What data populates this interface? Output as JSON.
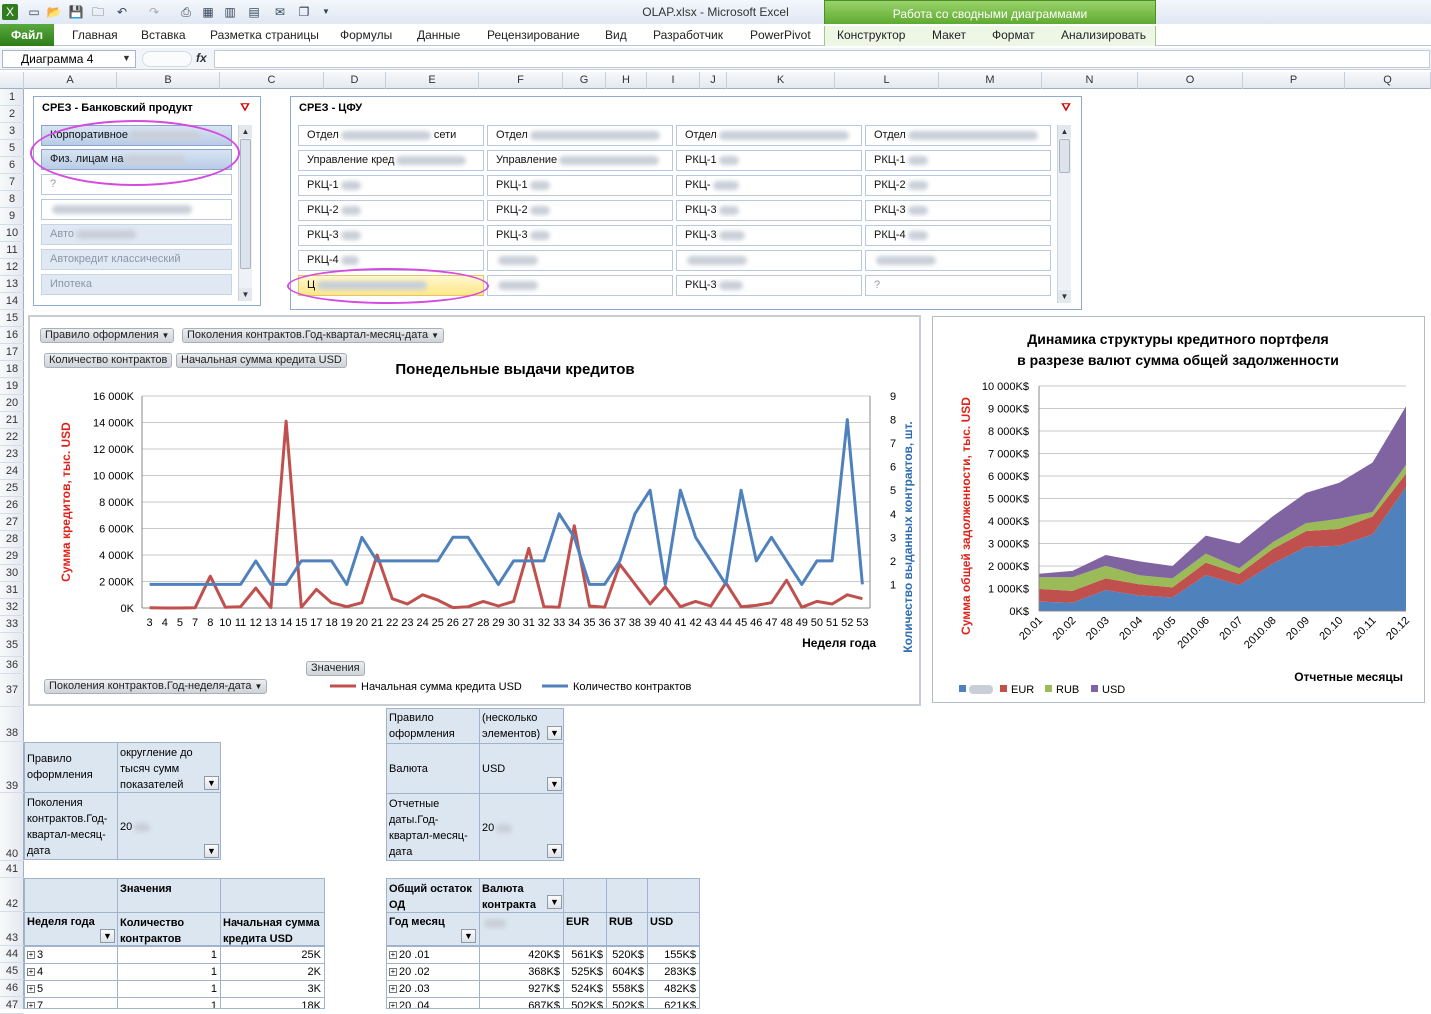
{
  "window": {
    "title": "OLAP.xlsx  -  Microsoft Excel",
    "context_group": "Работа со сводными диаграммами"
  },
  "ribbon": {
    "file_tab": "Файл",
    "tabs": [
      "Главная",
      "Вставка",
      "Разметка страницы",
      "Формулы",
      "Данные",
      "Рецензирование",
      "Вид",
      "Разработчик",
      "PowerPivot"
    ],
    "context_tabs": [
      "Конструктор",
      "Макет",
      "Формат",
      "Анализировать"
    ]
  },
  "formula_bar": {
    "name_box": "Диаграмма 4",
    "fx": "fx",
    "value": ""
  },
  "columns": [
    "A",
    "B",
    "C",
    "D",
    "E",
    "F",
    "G",
    "H",
    "I",
    "J",
    "K",
    "L",
    "M",
    "N",
    "O",
    "P",
    "Q"
  ],
  "rows": [
    "1",
    "2",
    "3",
    "5",
    "6",
    "7",
    "8",
    "9",
    "10",
    "11",
    "12",
    "13",
    "14",
    "15",
    "16",
    "17",
    "18",
    "19",
    "20",
    "21",
    "22",
    "23",
    "24",
    "25",
    "26",
    "27",
    "28",
    "29",
    "30",
    "31",
    "32",
    "33",
    "35",
    "36",
    "37",
    "38",
    "39",
    "40",
    "41",
    "42",
    "43",
    "44",
    "45",
    "46",
    "47"
  ],
  "slicer_product": {
    "title": "СРЕЗ - Банковский продукт",
    "items": [
      "Корпоративное",
      "Физ. лицам на",
      "?",
      "",
      "Авто",
      "Автокредит классический",
      "Ипотека"
    ]
  },
  "slicer_cfu": {
    "title": "СРЕЗ - ЦФУ",
    "items": [
      [
        "Отдел",
        "Отдел",
        "Отдел",
        "Отдел"
      ],
      [
        "Управление кред",
        "Управление",
        "РКЦ-1",
        "РКЦ-1"
      ],
      [
        "РКЦ-1",
        "РКЦ-1",
        "РКЦ-",
        "РКЦ-2"
      ],
      [
        "РКЦ-2",
        "РКЦ-2",
        "РКЦ-3",
        "РКЦ-3"
      ],
      [
        "РКЦ-3",
        "РКЦ-3",
        "РКЦ-3",
        "РКЦ-4"
      ],
      [
        "РКЦ-4",
        "",
        "",
        ""
      ],
      [
        "Ц",
        "",
        "РКЦ-3",
        "?"
      ]
    ],
    "row1_suffixes": [
      "сети",
      "",
      "",
      ""
    ]
  },
  "chart_weekly": {
    "filter_buttons": [
      "Правило оформления",
      "Поколения контрактов.Год-квартал-месяц-дата"
    ],
    "value_buttons": [
      "Количество контрактов",
      "Начальная сумма кредита USD"
    ],
    "values_button": "Значения",
    "axis_button": "Поколения контрактов.Год-неделя-дата",
    "legend_entries": [
      "Начальная сумма кредита USD",
      "Количество контрактов"
    ]
  },
  "chart_data": [
    {
      "type": "line",
      "title": "Понедельные выдачи кредитов",
      "xlabel": "Неделя года",
      "ylabel": "Сумма кредитов, тыс. USD",
      "y2label": "Количество выданных контрактов, шт.",
      "ylim": [
        0,
        16000
      ],
      "y2lim": [
        0,
        9
      ],
      "y_ticks": [
        "0K",
        "2 000K",
        "4 000K",
        "6 000K",
        "8 000K",
        "10 000K",
        "12 000K",
        "14 000K",
        "16 000K"
      ],
      "y2_ticks": [
        "1",
        "2",
        "3",
        "4",
        "5",
        "6",
        "7",
        "8",
        "9"
      ],
      "categories": [
        "3",
        "4",
        "5",
        "7",
        "8",
        "10",
        "11",
        "12",
        "13",
        "14",
        "15",
        "17",
        "18",
        "19",
        "20",
        "21",
        "22",
        "23",
        "24",
        "25",
        "26",
        "27",
        "28",
        "29",
        "30",
        "31",
        "32",
        "33",
        "34",
        "35",
        "36",
        "37",
        "38",
        "39",
        "40",
        "41",
        "42",
        "43",
        "44",
        "45",
        "46",
        "47",
        "48",
        "49",
        "50",
        "51",
        "52",
        "53"
      ],
      "legend": "bottom",
      "series": [
        {
          "name": "Начальная сумма кредита USD",
          "axis": "left",
          "color": "#c0504d",
          "values": [
            25,
            2,
            3,
            18,
            2400,
            50,
            100,
            1500,
            30,
            14100,
            50,
            1400,
            400,
            100,
            400,
            4000,
            700,
            300,
            1000,
            600,
            30,
            100,
            500,
            150,
            500,
            4500,
            100,
            50,
            6200,
            150,
            50,
            3300,
            1800,
            300,
            1600,
            100,
            500,
            150,
            1900,
            100,
            200,
            400,
            2100,
            50,
            500,
            300,
            1000,
            700
          ]
        },
        {
          "name": "Количество контрактов",
          "axis": "right",
          "color": "#4f81bd",
          "values": [
            1,
            1,
            1,
            1,
            1,
            1,
            1,
            2,
            1,
            1,
            2,
            2,
            2,
            1,
            3,
            2,
            2,
            2,
            2,
            2,
            3,
            3,
            2,
            1,
            2,
            2,
            2,
            4,
            3,
            1,
            1,
            2,
            4,
            5,
            1,
            5,
            3,
            2,
            1,
            5,
            2,
            3,
            2,
            1,
            2,
            2,
            8,
            1
          ]
        }
      ]
    },
    {
      "type": "area",
      "title": "Динамика  структуры  кредитного портфеля\nв разрезе  валют сумма общей задолженности",
      "xlabel": "Отчетные месяцы",
      "ylabel": "Сумма общей задолженности, тыс. USD",
      "ylim": [
        0,
        10000
      ],
      "y_ticks": [
        "0K$",
        "1 000K$",
        "2 000K$",
        "3 000K$",
        "4 000K$",
        "5 000K$",
        "6 000K$",
        "7 000K$",
        "8 000K$",
        "9 000K$",
        "10 000K$"
      ],
      "categories": [
        "20.01",
        "20.02",
        "20.03",
        "20.04",
        "20.05",
        "2010.06",
        "20.07",
        "2010.08",
        "20.09",
        "20.10",
        "20.11",
        "20.12"
      ],
      "stacked": true,
      "legend": "bottom",
      "series": [
        {
          "name": "",
          "color": "#4f81bd",
          "values": [
            420,
            368,
            927,
            687,
            600,
            1600,
            1150,
            2100,
            2850,
            2900,
            3400,
            5500
          ]
        },
        {
          "name": "EUR",
          "color": "#c0504d",
          "values": [
            561,
            525,
            524,
            502,
            450,
            550,
            500,
            650,
            700,
            750,
            800,
            600
          ]
        },
        {
          "name": "RUB",
          "color": "#9bbb59",
          "values": [
            520,
            604,
            558,
            400,
            400,
            400,
            250,
            300,
            350,
            450,
            200,
            400
          ]
        },
        {
          "name": "USD",
          "color": "#8064a2",
          "values": [
            155,
            283,
            482,
            621,
            550,
            800,
            1100,
            1150,
            1350,
            1600,
            2200,
            2600
          ]
        }
      ]
    }
  ],
  "pivot_left": {
    "filter1_label": "Правило оформления",
    "filter1_value": "округление до тысяч сумм показателей",
    "filter2_label": "Поколения контрактов.Год-квартал-месяц-дата",
    "filter2_value": "20",
    "values_header": "Значения",
    "col_week": "Неделя года",
    "col_count": "Количество контрактов",
    "col_sum": "Начальная сумма кредита USD",
    "rows": [
      {
        "week": "3",
        "count": "1",
        "sum": "25K"
      },
      {
        "week": "4",
        "count": "1",
        "sum": "2K"
      },
      {
        "week": "5",
        "count": "1",
        "sum": "3K"
      },
      {
        "week": "7",
        "count": "1",
        "sum": "18K"
      }
    ]
  },
  "pivot_right": {
    "filter1_label": "Правило оформления",
    "filter1_value": "(несколько элементов)",
    "filter2_label": "Валюта",
    "filter2_value": "USD",
    "filter3_label": "Отчетные даты.Год-квартал-месяц-дата",
    "filter3_value": "20",
    "corner": "Общий остаток ОД",
    "currency_header": "Валюта контракта",
    "col_month": "Год месяц",
    "col_cur": [
      "",
      "EUR",
      "RUB",
      "USD"
    ],
    "rows": [
      {
        "month": "20 .01",
        "v": [
          "420K$",
          "561K$",
          "520K$",
          "155K$"
        ]
      },
      {
        "month": "20 .02",
        "v": [
          "368K$",
          "525K$",
          "604K$",
          "283K$"
        ]
      },
      {
        "month": "20 .03",
        "v": [
          "927K$",
          "524K$",
          "558K$",
          "482K$"
        ]
      },
      {
        "month": "20 .04",
        "v": [
          "687K$",
          "502K$",
          "502K$",
          "621K$"
        ]
      }
    ]
  }
}
